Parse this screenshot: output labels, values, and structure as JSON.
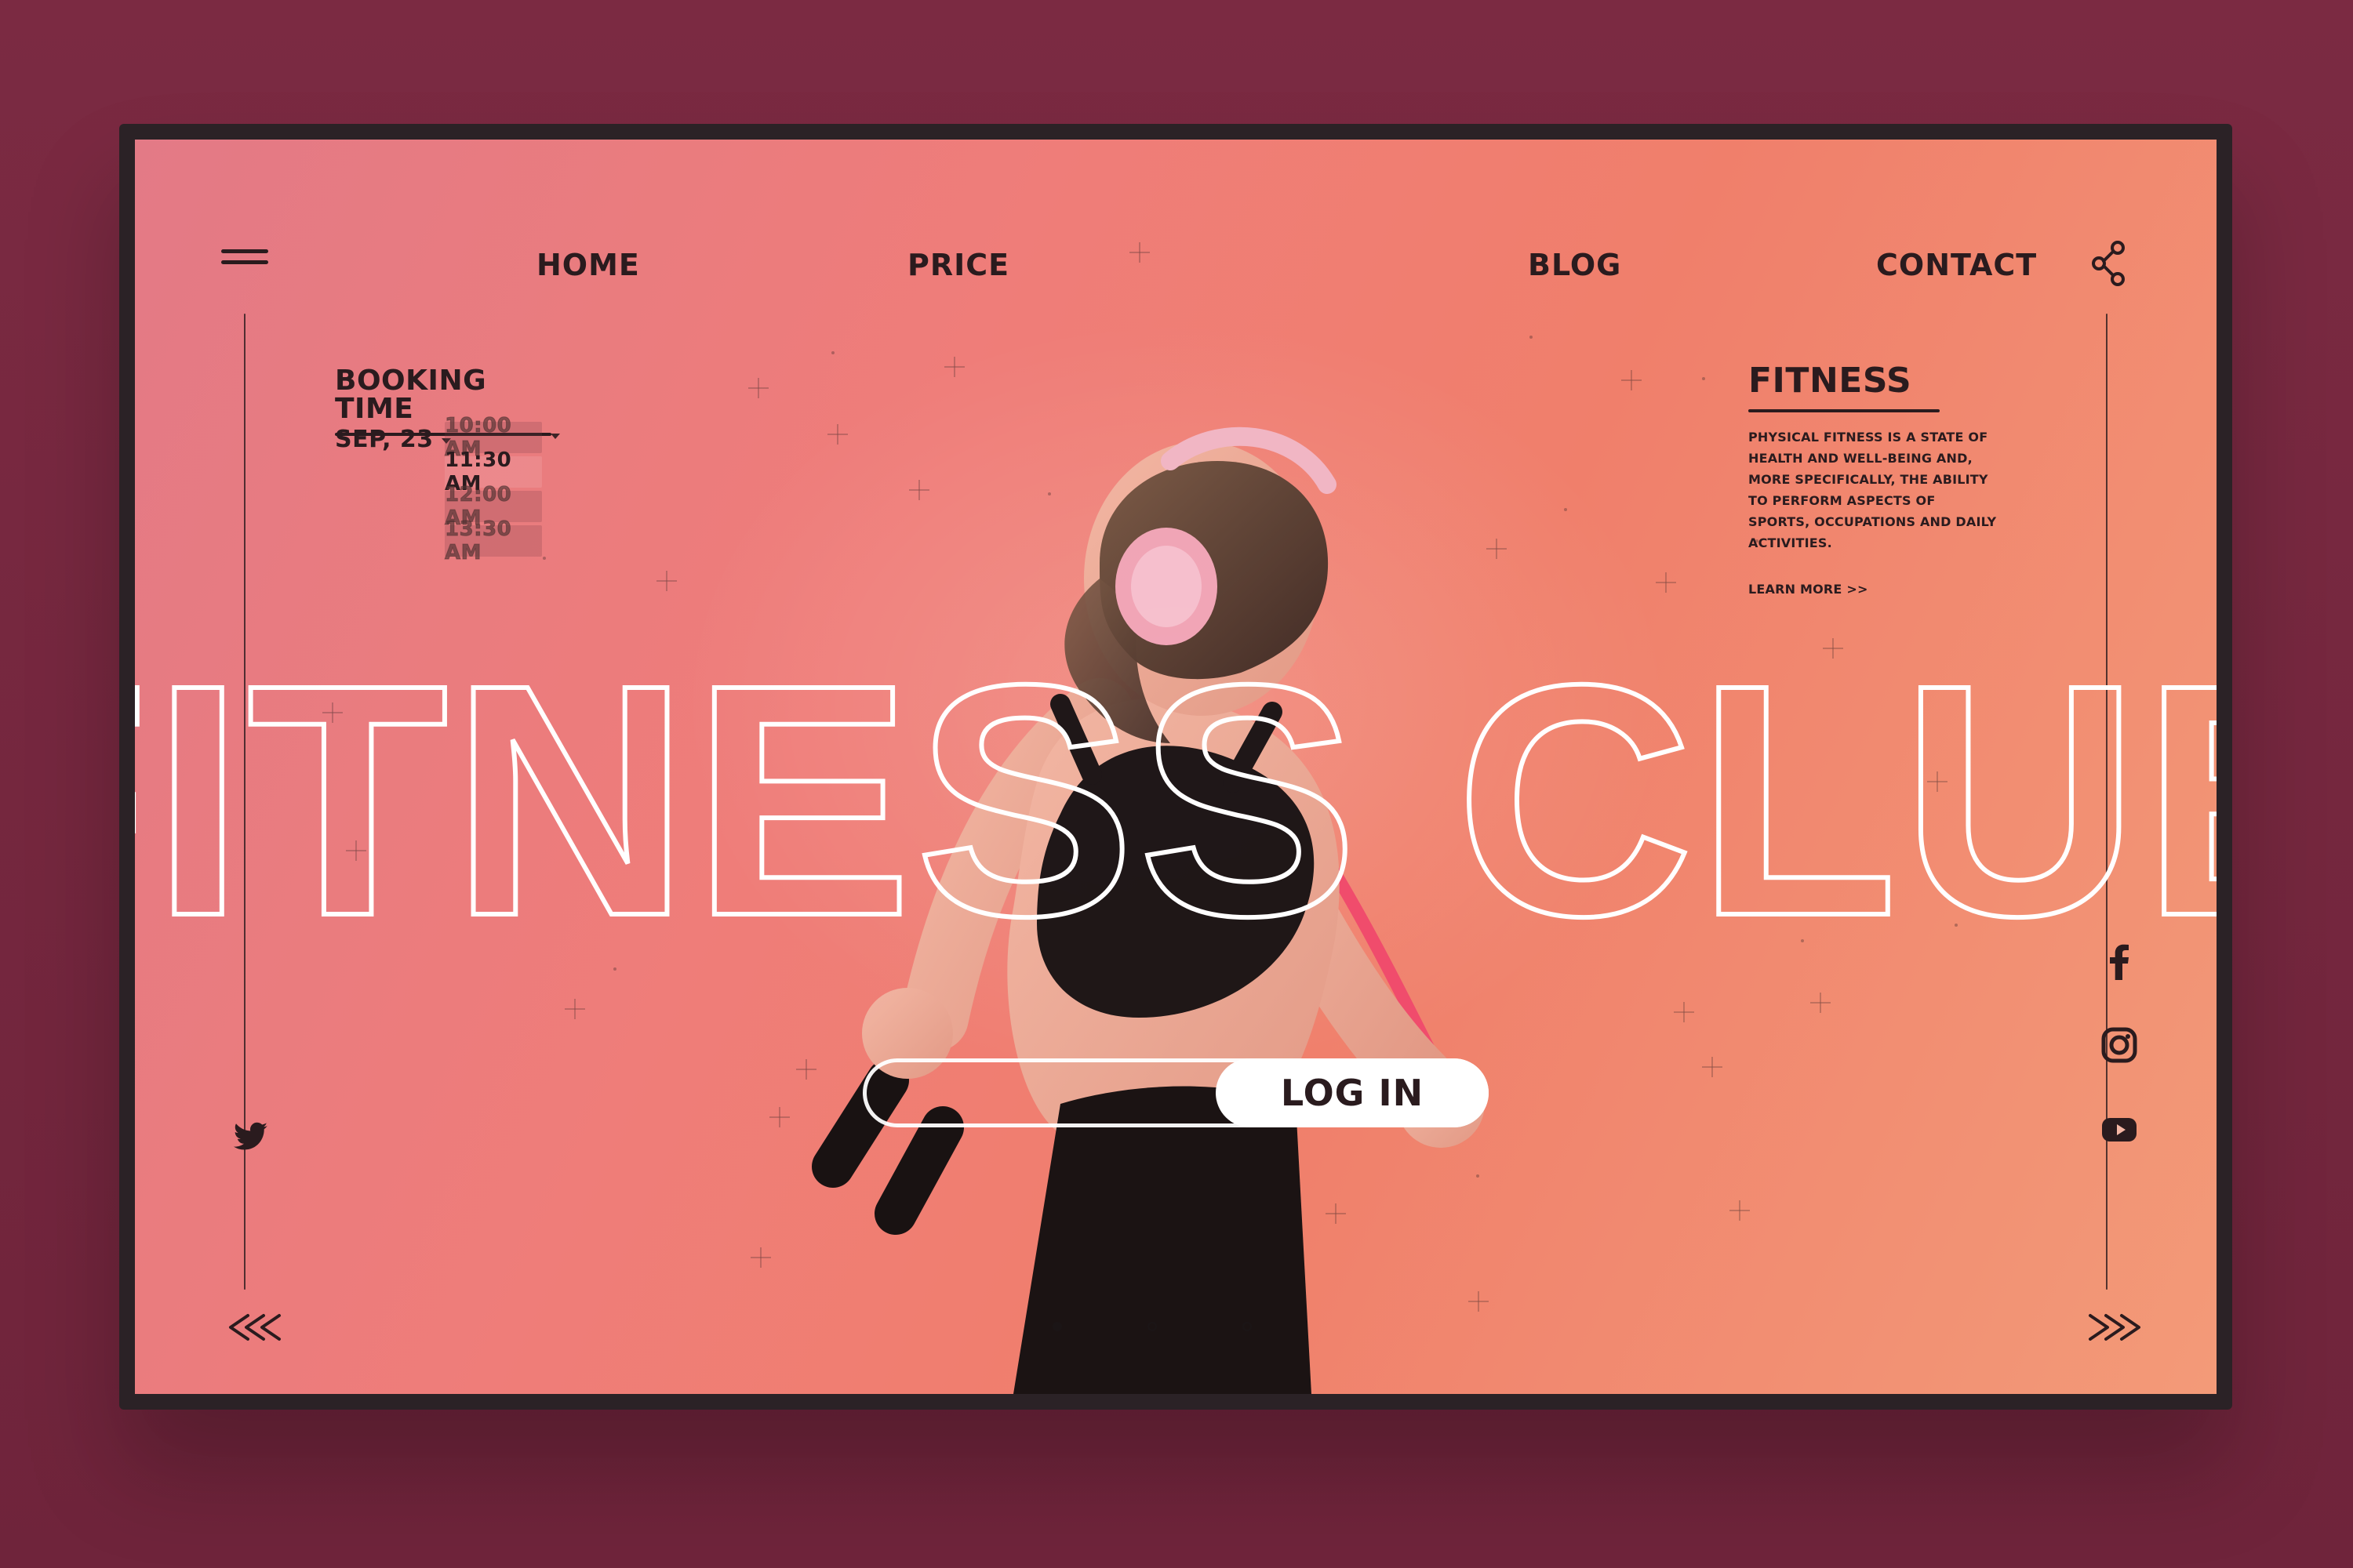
{
  "nav": {
    "items": [
      {
        "label": "HOME"
      },
      {
        "label": "PRICE"
      },
      {
        "label": "BLOG"
      },
      {
        "label": "CONTACT"
      }
    ],
    "icons": {
      "menu": "menu-icon",
      "share": "share-icon"
    }
  },
  "booking": {
    "title": "BOOKING TIME",
    "date": "SEP, 23",
    "times": [
      "10:00 AM",
      "11:30 AM",
      "12:00 AM",
      "13:30 AM"
    ],
    "selected_time": "11:30 AM"
  },
  "info": {
    "title": "FITNESS",
    "body": "PHYSICAL FITNESS IS A STATE OF HEALTH AND WELL-BEING AND, MORE SPECIFICALLY, THE ABILITY TO PERFORM ASPECTS OF SPORTS, OCCUPATIONS AND DAILY ACTIVITIES.",
    "learn_more": "LEARN MORE >>"
  },
  "hero": {
    "title": "FITNESS CLUB",
    "login_label": "LOG IN"
  },
  "social": {
    "left": [
      "twitter-icon"
    ],
    "right": [
      "facebook-icon",
      "instagram-icon",
      "youtube-icon"
    ]
  },
  "carousel": {
    "dots": 3,
    "active_index": 0
  },
  "colors": {
    "page_bg": "#76283f",
    "frame": "#2b2226",
    "accent_dark": "#2a1b1e",
    "gradient_start": "#e37a86",
    "gradient_end": "#f39a78",
    "white": "#ffffff"
  }
}
